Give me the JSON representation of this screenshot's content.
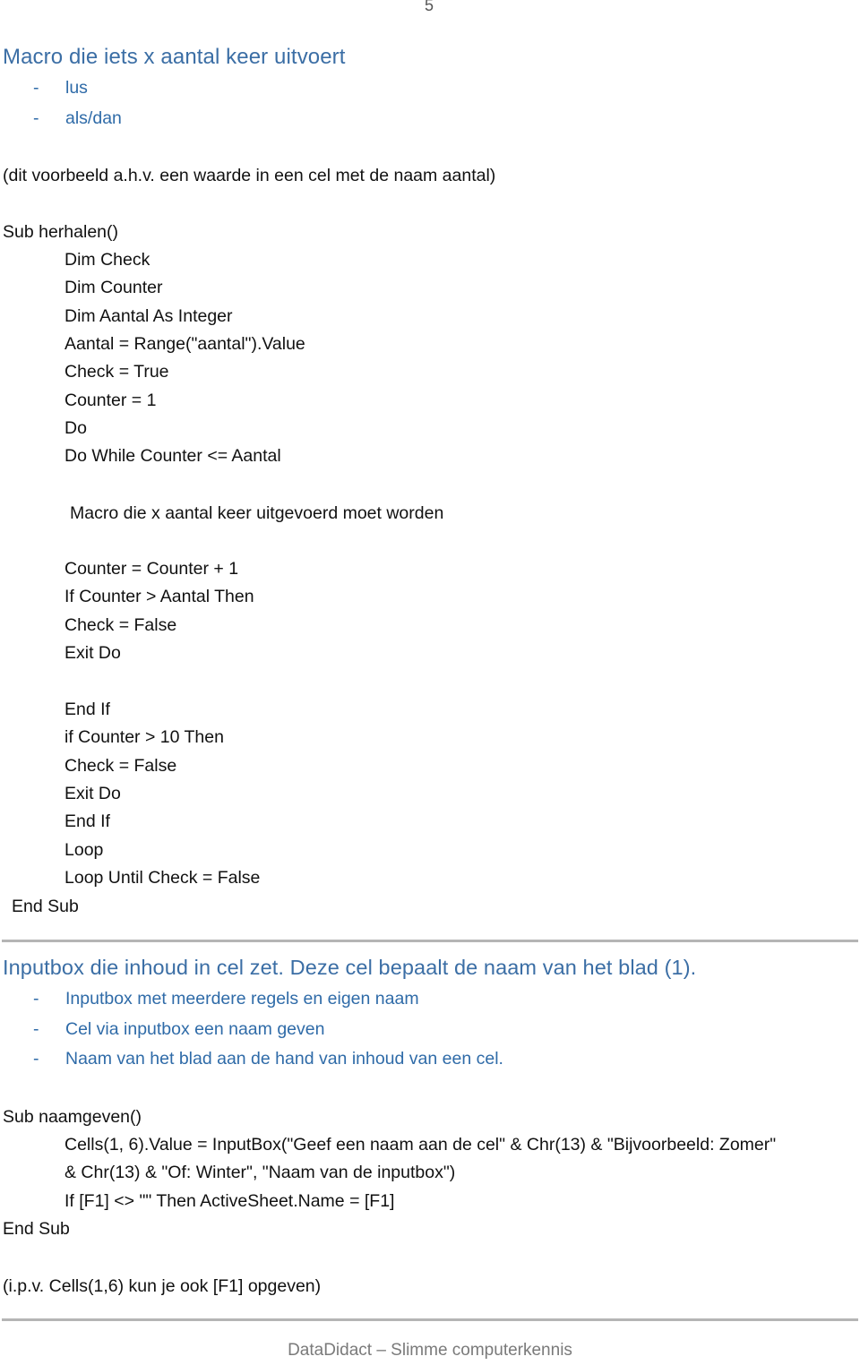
{
  "page": {
    "number": "5"
  },
  "section1": {
    "heading": "Macro die iets x aantal keer uitvoert",
    "bullets": [
      "lus",
      "als/dan"
    ],
    "bullet_marker": "-",
    "note": "(dit voorbeeld a.h.v. een waarde in een cel met de naam aantal)",
    "code": {
      "sub_start": "Sub herhalen()",
      "body_top": [
        "Dim Check",
        "Dim Counter",
        "Dim Aantal As Integer",
        "Aantal = Range(\"aantal\").Value",
        "Check = True",
        "Counter = 1",
        "Do",
        "Do While Counter <= Aantal"
      ],
      "placeholder": "Macro die x aantal keer uitgevoerd moet worden",
      "body_mid": [
        "Counter = Counter + 1",
        "If Counter > Aantal Then",
        "Check = False",
        "Exit Do"
      ],
      "body_bottom": [
        "End If",
        "if Counter > 10 Then",
        "Check = False",
        "Exit Do",
        "End If",
        "Loop",
        "Loop Until Check = False"
      ],
      "sub_end": "End Sub"
    }
  },
  "section2": {
    "heading": "Inputbox die inhoud in cel zet. Deze cel bepaalt de naam van het blad (1).",
    "bullets": [
      "Inputbox met meerdere regels en eigen naam",
      "Cel via inputbox een naam geven",
      "Naam van het blad aan de hand van inhoud van een cel."
    ],
    "bullet_marker": "-",
    "code": {
      "sub_start": "Sub naamgeven()",
      "body": [
        "Cells(1, 6).Value = InputBox(\"Geef een naam aan de cel\" & Chr(13) & \"Bijvoorbeeld: Zomer\"",
        "& Chr(13) & \"Of: Winter\", \"Naam van de inputbox\")",
        "If [F1] <> \"\" Then ActiveSheet.Name = [F1]"
      ],
      "sub_end": "End Sub"
    },
    "note": "(i.p.v. Cells(1,6) kun je ook [F1] opgeven)"
  },
  "footer": {
    "text": "DataDidact – Slimme computerkennis"
  },
  "colors": {
    "heading": "#3b6ea5",
    "bullet_text": "#2f6ba8",
    "body_text": "#111111",
    "divider": "#b5b5b5",
    "footer_text": "#7a7a7a"
  }
}
